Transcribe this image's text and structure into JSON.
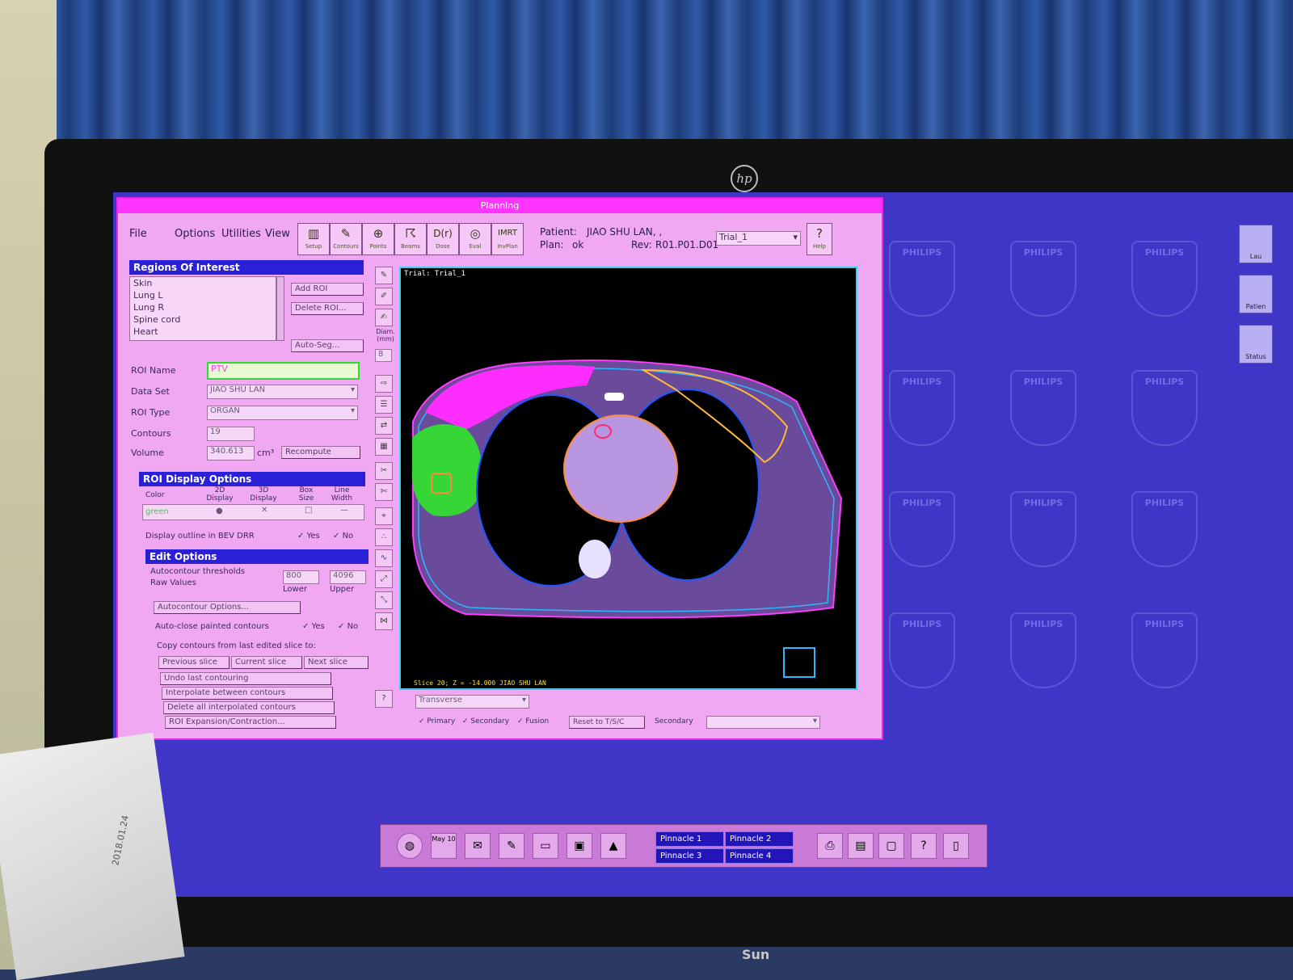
{
  "window": {
    "title": "Planning"
  },
  "menu": {
    "file": "File",
    "options": "Options",
    "utilities": "Utilities",
    "view": "View"
  },
  "toolbar": [
    {
      "label": "Setup",
      "icon": "setup-icon"
    },
    {
      "label": "Contours",
      "icon": "contours-icon"
    },
    {
      "label": "Points",
      "icon": "points-icon"
    },
    {
      "label": "Beams",
      "icon": "beams-icon"
    },
    {
      "label": "Dose",
      "icon": "dose-icon"
    },
    {
      "label": "Eval",
      "icon": "eval-icon"
    },
    {
      "label": "InvPlan",
      "icon": "imrt-icon"
    }
  ],
  "toolbar_glyphs": {
    "dose": "D(r)",
    "imrt": "IMRT"
  },
  "patient": {
    "patient_label": "Patient:",
    "patient_name": "JIAO SHU LAN, ,",
    "plan_label": "Plan:",
    "plan_value": "ok",
    "rev_label": "Rev:",
    "rev_value": "R01.P01.D01",
    "trial": "Trial_1",
    "help": "Help"
  },
  "roi": {
    "header": "Regions Of Interest",
    "items": [
      "Skin",
      "Lung L",
      "Lung R",
      "Spine cord",
      "Heart"
    ],
    "add_button": "Add ROI",
    "delete_button": "Delete ROI...",
    "autoseg_button": "Auto-Seg...",
    "diam_label": "Diam. (mm)",
    "diam_value": "8",
    "name_label": "ROI Name",
    "name_value": "PTV",
    "dataset_label": "Data Set",
    "dataset_value": "JIAO SHU LAN",
    "type_label": "ROI Type",
    "type_value": "ORGAN",
    "contours_label": "Contours",
    "contours_value": "19",
    "volume_label": "Volume",
    "volume_value": "340.613",
    "volume_unit": "cm³",
    "recompute_button": "Recompute"
  },
  "display": {
    "header": "ROI Display Options",
    "col_color": "Color",
    "col_2d": "2D Display",
    "col_3d": "3D Display",
    "col_box": "Box Size",
    "col_line": "Line Width",
    "color_value": "green",
    "bev_label": "Display outline in BEV DRR",
    "yes": "Yes",
    "no": "No"
  },
  "edit": {
    "header": "Edit Options",
    "thresholds_label": "Autocontour thresholds",
    "raw_label": "Raw Values",
    "lower_value": "800",
    "upper_value": "4096",
    "lower_label": "Lower",
    "upper_label": "Upper",
    "autocontour_button": "Autocontour Options...",
    "autoclose_label": "Auto-close painted contours",
    "yes": "Yes",
    "no": "No",
    "copy_label": "Copy contours from last edited slice to:",
    "prev_button": "Previous slice",
    "current_button": "Current slice",
    "next_button": "Next slice",
    "undo_button": "Undo last contouring",
    "interp_button": "Interpolate between contours",
    "delete_interp_button": "Delete all interpolated contours",
    "expand_button": "ROI Expansion/Contraction..."
  },
  "viewer": {
    "trial_label": "Trial: Trial_1",
    "slice_label": "Slice 20; Z = -14.000 JIAO SHU LAN",
    "orientation": "Transverse",
    "primary": "Primary",
    "secondary": "Secondary",
    "fusion": "Fusion",
    "reset_button": "Reset to T/S/C",
    "secondary_label": "Secondary"
  },
  "taskbar": {
    "p1": "Pinnacle 1",
    "p2": "Pinnacle 2",
    "p3": "Pinnacle 3",
    "p4": "Pinnacle 4",
    "date_icon": "May 10"
  },
  "right_sidebar": [
    "Lau",
    "Patien",
    "Status"
  ],
  "colors": {
    "desktop": "#3f36c8",
    "window": "#f0a8f2",
    "titlebar": "#ff35ff",
    "header": "#2a20d8",
    "ptv": "#36d636",
    "skin": "#ff3cff",
    "heart": "#ff8a3a",
    "lung": "#2255ff"
  },
  "watermark": "PHILIPS",
  "monitor": {
    "brand": "hp",
    "base_brand": "Sun"
  }
}
